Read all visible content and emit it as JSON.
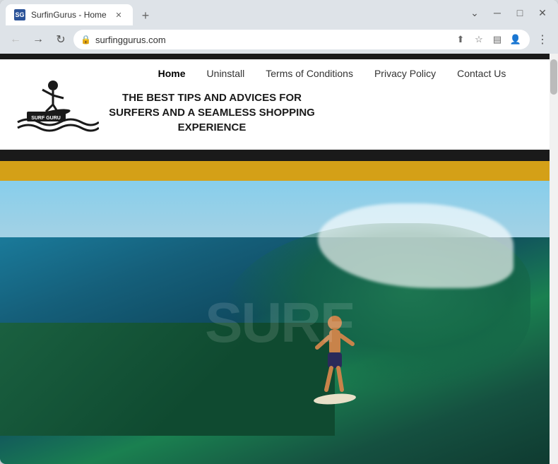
{
  "browser": {
    "tab_favicon": "SG",
    "tab_title": "SurfinGurus - Home",
    "url": "surfinggurus.com",
    "url_protocol": "https",
    "window_controls": {
      "minimize": "─",
      "maximize": "□",
      "close": "✕"
    }
  },
  "nav": {
    "links": [
      {
        "label": "Home",
        "active": true
      },
      {
        "label": "Uninstall",
        "active": false
      },
      {
        "label": "Terms of Conditions",
        "active": false
      },
      {
        "label": "Privacy Policy",
        "active": false
      },
      {
        "label": "Contact Us",
        "active": false
      }
    ]
  },
  "hero": {
    "tagline_line1": "THE BEST TIPS AND ADVICES FOR SURFERS AND A SEAMLESS SHOPPING",
    "tagline_line2": "EXPERIENCE"
  },
  "logo": {
    "brand": "SURF GURU"
  }
}
